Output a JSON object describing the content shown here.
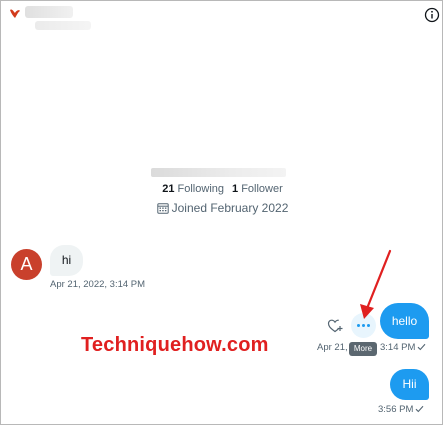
{
  "header": {
    "avatar_icon": "profile-avatar-icon",
    "info_icon": "info-icon"
  },
  "profile": {
    "following_count": "21",
    "following_label": "Following",
    "followers_count": "1",
    "followers_label": "Follower",
    "joined_text": "Joined February 2022",
    "calendar_icon": "calendar-icon"
  },
  "conversation": {
    "received": [
      {
        "avatar_letter": "A",
        "text": "hi",
        "timestamp": "Apr 21, 2022, 3:14 PM"
      }
    ],
    "sent": [
      {
        "text": "hello",
        "timestamp_prefix": "Apr 21,",
        "timestamp": "3:14 PM"
      },
      {
        "text": "Hii",
        "timestamp": "3:56 PM"
      }
    ],
    "actions": {
      "more_tooltip": "More",
      "like_icon": "heart-plus-icon",
      "more_icon": "ellipsis-icon"
    }
  },
  "watermark": "Techniquehow.com",
  "colors": {
    "accent": "#1d9bf0",
    "avatar_bg": "#c9402c",
    "watermark": "#e02020",
    "annotation_arrow": "#e02020"
  }
}
